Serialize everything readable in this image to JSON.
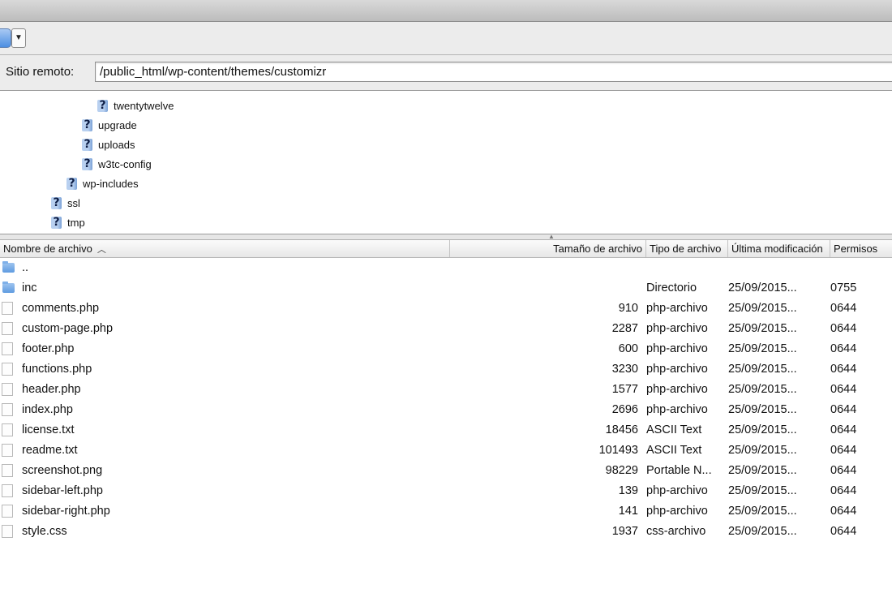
{
  "path_bar": {
    "label": "Sitio remoto:",
    "value": "/public_html/wp-content/themes/customizr"
  },
  "tree": {
    "items": [
      {
        "label": "twentytwelve",
        "level": 4
      },
      {
        "label": "upgrade",
        "level": 3
      },
      {
        "label": "uploads",
        "level": 3
      },
      {
        "label": "w3tc-config",
        "level": 3
      },
      {
        "label": "wp-includes",
        "level": 2
      },
      {
        "label": "ssl",
        "level": 1
      },
      {
        "label": "tmp",
        "level": 1
      }
    ]
  },
  "columns": {
    "name": "Nombre de archivo",
    "size": "Tamaño de archivo",
    "type": "Tipo de archivo",
    "modified": "Última modificación",
    "permissions": "Permisos"
  },
  "files": [
    {
      "name": "..",
      "size": "",
      "type": "",
      "modified": "",
      "perms": "",
      "icon": "folder-icon"
    },
    {
      "name": "inc",
      "size": "",
      "type": "Directorio",
      "modified": "25/09/2015...",
      "perms": "0755",
      "icon": "folder-icon"
    },
    {
      "name": "comments.php",
      "size": "910",
      "type": "php-archivo",
      "modified": "25/09/2015...",
      "perms": "0644",
      "icon": "file-icon"
    },
    {
      "name": "custom-page.php",
      "size": "2287",
      "type": "php-archivo",
      "modified": "25/09/2015...",
      "perms": "0644",
      "icon": "file-icon"
    },
    {
      "name": "footer.php",
      "size": "600",
      "type": "php-archivo",
      "modified": "25/09/2015...",
      "perms": "0644",
      "icon": "file-icon"
    },
    {
      "name": "functions.php",
      "size": "3230",
      "type": "php-archivo",
      "modified": "25/09/2015...",
      "perms": "0644",
      "icon": "file-icon"
    },
    {
      "name": "header.php",
      "size": "1577",
      "type": "php-archivo",
      "modified": "25/09/2015...",
      "perms": "0644",
      "icon": "file-icon"
    },
    {
      "name": "index.php",
      "size": "2696",
      "type": "php-archivo",
      "modified": "25/09/2015...",
      "perms": "0644",
      "icon": "file-icon"
    },
    {
      "name": "license.txt",
      "size": "18456",
      "type": "ASCII Text",
      "modified": "25/09/2015...",
      "perms": "0644",
      "icon": "file-icon"
    },
    {
      "name": "readme.txt",
      "size": "101493",
      "type": "ASCII Text",
      "modified": "25/09/2015...",
      "perms": "0644",
      "icon": "file-icon"
    },
    {
      "name": "screenshot.png",
      "size": "98229",
      "type": "Portable N...",
      "modified": "25/09/2015...",
      "perms": "0644",
      "icon": "file-icon"
    },
    {
      "name": "sidebar-left.php",
      "size": "139",
      "type": "php-archivo",
      "modified": "25/09/2015...",
      "perms": "0644",
      "icon": "file-icon"
    },
    {
      "name": "sidebar-right.php",
      "size": "141",
      "type": "php-archivo",
      "modified": "25/09/2015...",
      "perms": "0644",
      "icon": "file-icon"
    },
    {
      "name": "style.css",
      "size": "1937",
      "type": "css-archivo",
      "modified": "25/09/2015...",
      "perms": "0644",
      "icon": "file-icon"
    }
  ],
  "colors": {
    "folder": "#5f9be0",
    "question_icon": "#b8d0f0",
    "toolbar_bg": "#ececec"
  }
}
